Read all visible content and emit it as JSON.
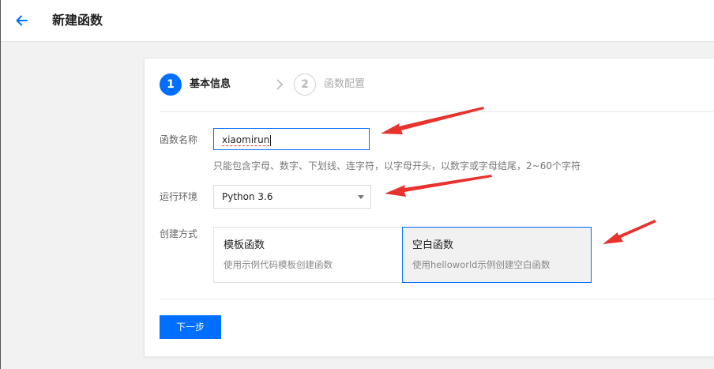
{
  "header": {
    "title": "新建函数",
    "back_icon": "arrow-left-icon"
  },
  "steps": [
    {
      "number": "1",
      "label": "基本信息",
      "state": "active"
    },
    {
      "number": "2",
      "label": "函数配置",
      "state": "inactive"
    }
  ],
  "form": {
    "name_label": "函数名称",
    "name_value": "xiaomirun",
    "name_hint": "只能包含字母、数字、下划线、连字符，以字母开头，以数字或字母结尾，2~60个字符",
    "runtime_label": "运行环境",
    "runtime_value": "Python 3.6",
    "method_label": "创建方式",
    "options": [
      {
        "title": "模板函数",
        "desc": "使用示例代码模板创建函数",
        "selected": false
      },
      {
        "title": "空白函数",
        "desc": "使用helloworld示例创建空白函数",
        "selected": true
      }
    ]
  },
  "next_button": "下一步",
  "colors": {
    "primary": "#006eff",
    "annotation_arrow": "#e8322e"
  }
}
